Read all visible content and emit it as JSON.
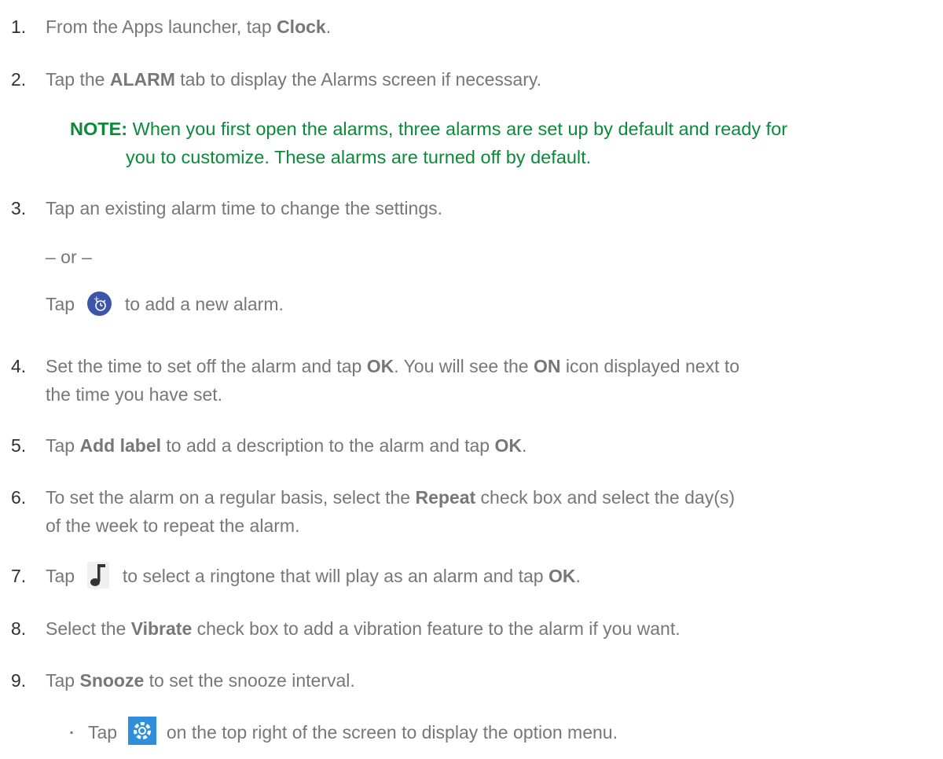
{
  "steps": [
    {
      "num": "1.",
      "parts": [
        "From the Apps launcher, tap ",
        "Clock",
        "."
      ]
    },
    {
      "num": "2.",
      "parts": [
        "Tap the ",
        "ALARM",
        " tab to display the Alarms screen if necessary."
      ]
    },
    {
      "num": "3.",
      "text": "Tap an existing alarm time to change the settings."
    },
    {
      "num": "4.",
      "parts": [
        "Set the time to set off the alarm and tap ",
        "OK",
        ". You will see the ",
        "ON",
        " icon displayed next to"
      ],
      "line2": "the time you have set."
    },
    {
      "num": "5.",
      "parts": [
        "Tap ",
        "Add label",
        " to add a description to the alarm and tap ",
        "OK",
        "."
      ]
    },
    {
      "num": "6.",
      "parts": [
        "To set the alarm on a regular basis, select the ",
        "Repeat",
        " check box and select the day(s)"
      ],
      "line2": "of the week to repeat the alarm."
    },
    {
      "num": "7.",
      "parts": [
        "Tap ",
        " to select a ringtone that will play as an alarm and tap ",
        "OK",
        "."
      ]
    },
    {
      "num": "8.",
      "parts": [
        "Select the ",
        "Vibrate",
        " check box to add a vibration feature to the alarm if you want."
      ]
    },
    {
      "num": "9.",
      "parts": [
        "Tap ",
        "Snooze",
        " to set the snooze interval."
      ]
    }
  ],
  "note": {
    "label": "NOTE:",
    "line1": " When you first open the alarms, three alarms are set up by default and ready for",
    "line2": "you to customize. These alarms are turned off by default."
  },
  "or_text": "– or –",
  "add_alarm": {
    "before": "Tap ",
    "after": " to add a new alarm."
  },
  "bullet": {
    "marker": "▪",
    "before": "Tap ",
    "after": " on the top right of the screen to display the option menu."
  },
  "colors": {
    "note_green": "#0b8a3a",
    "alarm_icon_blue": "#3d55a8",
    "gear_icon_blue": "#2f8fdc"
  },
  "icons": [
    "add-alarm-icon",
    "ringtone-note-icon",
    "settings-gear-icon"
  ]
}
